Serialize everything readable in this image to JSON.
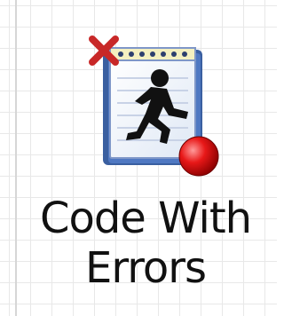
{
  "item": {
    "label_line1": "Code With",
    "label_line2": "Errors",
    "icon": "script-error-icon",
    "colors": {
      "grid_line": "#e8e8e8",
      "notepad_blue": "#3a5fa0",
      "error_red": "#d60000",
      "x_mark": "#c82828"
    }
  }
}
